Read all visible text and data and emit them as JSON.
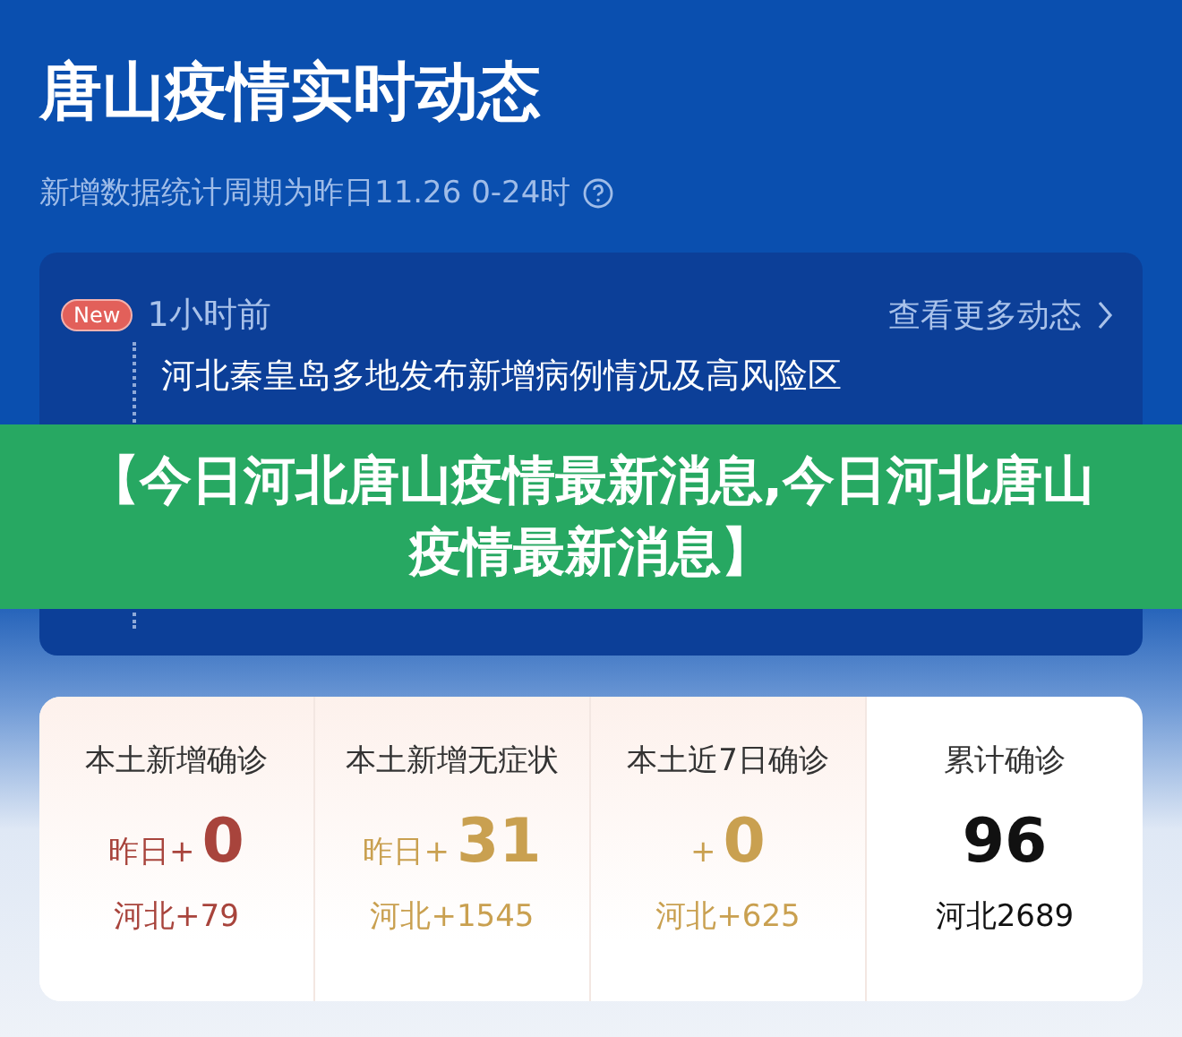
{
  "header": {
    "title": "唐山疫情实时动态",
    "subtitle": "新增数据统计周期为昨日11.26 0-24时"
  },
  "news": {
    "more_link": "查看更多动态",
    "items": [
      {
        "is_new": true,
        "badge": "New",
        "time": "1小时前",
        "headline": "河北秦皇岛多地发布新增病例情况及高风险区"
      }
    ]
  },
  "banner": {
    "text": "【今日河北唐山疫情最新消息,今日河北唐山疫情最新消息】"
  },
  "stats": [
    {
      "label": "本土新增确诊",
      "prefix": "昨日+",
      "value": "0",
      "sub": "河北+79",
      "color": "#a8443c"
    },
    {
      "label": "本土新增无症状",
      "prefix": "昨日+",
      "value": "31",
      "sub": "河北+1545",
      "color": "#c9a050"
    },
    {
      "label": "本土近7日确诊",
      "prefix": "+",
      "value": "0",
      "sub": "河北+625",
      "color": "#c9a050"
    },
    {
      "label": "累计确诊",
      "value": "96",
      "sub": "河北2689",
      "color": "#111111"
    }
  ]
}
